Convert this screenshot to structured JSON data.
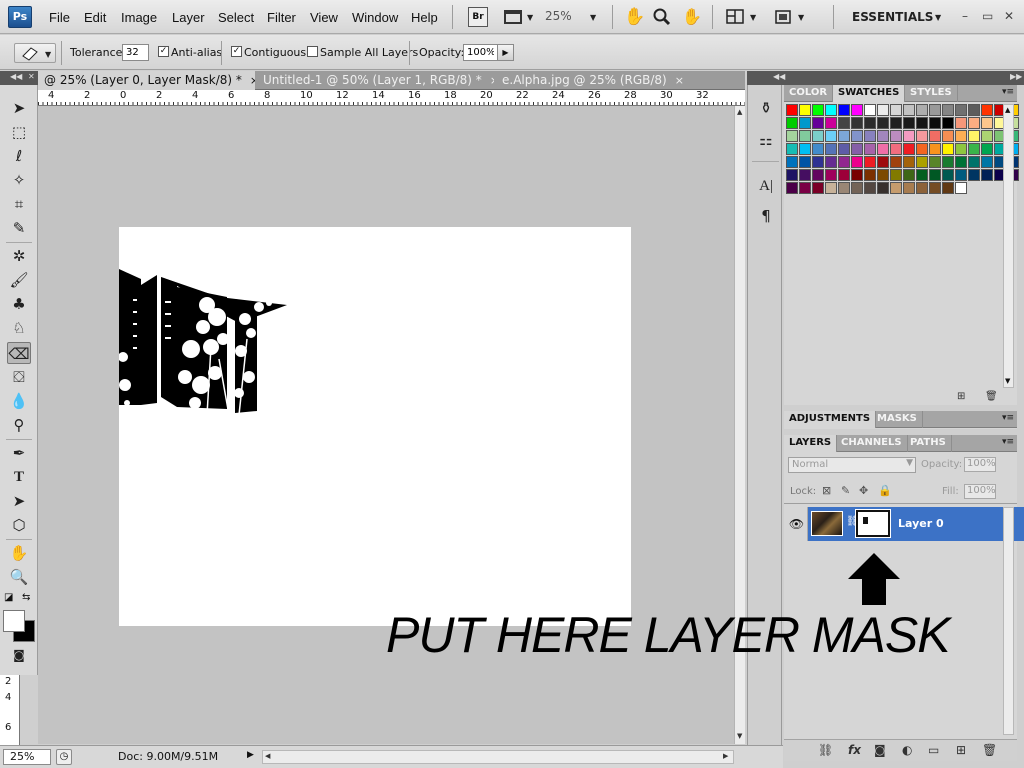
{
  "app": {
    "logo": "Ps"
  },
  "menubar": {
    "items": [
      "File",
      "Edit",
      "Image",
      "Layer",
      "Select",
      "Filter",
      "View",
      "Window",
      "Help"
    ],
    "bridge": "Br",
    "zoom": "25%",
    "workspace": "ESSENTIALS",
    "window_controls": [
      "–",
      "▭",
      "✕"
    ]
  },
  "options": {
    "tolerance_label": "Tolerance:",
    "tolerance_value": "32",
    "antialias_label": "Anti-alias",
    "antialias_checked": true,
    "contiguous_label": "Contiguous",
    "contiguous_checked": true,
    "sample_all_label": "Sample All Layers",
    "sample_all_checked": false,
    "opacity_label": "Opacity:",
    "opacity_value": "100%"
  },
  "doc_tabs": [
    {
      "label": "@ 25% (Layer 0, Layer Mask/8) *",
      "close": "×",
      "active": true
    },
    {
      "label": "Untitled-1 @ 50% (Layer 1, RGB/8) *",
      "close": "×",
      "active": false
    },
    {
      "label": "e.Alpha.jpg @ 25% (RGB/8)",
      "close": "×",
      "active": false
    }
  ],
  "ruler": {
    "h_labels": [
      "4",
      "2",
      "0",
      "2",
      "4",
      "6",
      "8",
      "10",
      "12",
      "14",
      "16",
      "18",
      "20",
      "22",
      "24",
      "26",
      "28",
      "30",
      "32"
    ],
    "v_labels": [
      "2",
      "4",
      "6"
    ]
  },
  "status": {
    "zoom": "25%",
    "doc": "Doc: 9.00M/9.51M"
  },
  "swatch_panel": {
    "tabs": [
      "COLOR",
      "SWATCHES",
      "STYLES"
    ],
    "active": "SWATCHES",
    "colors": [
      "#ff0000",
      "#ffff00",
      "#00ff00",
      "#00ffff",
      "#0000ff",
      "#ff00ff",
      "#ffffff",
      "#ebebeb",
      "#d6d6d6",
      "#c2c2c2",
      "#adadad",
      "#999999",
      "#858585",
      "#707070",
      "#5c5c5c",
      "#ff3300",
      "#cc0000",
      "#ffcc00",
      "#00cc00",
      "#0099cc",
      "#660099",
      "#cc0099",
      "#444444",
      "#333333",
      "#2b2b2b",
      "#262626",
      "#1f1f1f",
      "#1a1a1a",
      "#141414",
      "#0d0d0d",
      "#000000",
      "#f7977a",
      "#fbad82",
      "#fdc68c",
      "#fff799",
      "#c6df9c",
      "#a4d49d",
      "#81ca9d",
      "#7bcdc9",
      "#6ccff7",
      "#7ca6d8",
      "#8293ca",
      "#8881be",
      "#a286bd",
      "#bc8cbf",
      "#f49bc1",
      "#f5999d",
      "#f16d64",
      "#f58e53",
      "#fdae54",
      "#fff467",
      "#acd372",
      "#7dc473",
      "#39b778",
      "#16bcb4",
      "#00bff3",
      "#438ccb",
      "#5573b7",
      "#5e5ca7",
      "#855fa8",
      "#a763a9",
      "#ef6ea8",
      "#f16d7e",
      "#ee1d23",
      "#f36521",
      "#f8931d",
      "#fff100",
      "#8dc63f",
      "#39b44a",
      "#00a650",
      "#00a99e",
      "#00adef",
      "#0072bc",
      "#0054a5",
      "#2f3192",
      "#652c91",
      "#91278f",
      "#ec008c",
      "#ed1c24",
      "#9e0b0f",
      "#a0410d",
      "#a3620a",
      "#aba000",
      "#588528",
      "#197b30",
      "#007236",
      "#00736a",
      "#0076a4",
      "#004a80",
      "#003370",
      "#1d1363",
      "#450e61",
      "#62055f",
      "#9e005c",
      "#9d0039",
      "#790000",
      "#7b3000",
      "#7c4900",
      "#827a00",
      "#3e6617",
      "#045f20",
      "#005824",
      "#005951",
      "#005b7e",
      "#003562",
      "#002056",
      "#0c004b",
      "#30004a",
      "#4b0048",
      "#7a0045",
      "#7a0026",
      "#c7b299",
      "#998675",
      "#736357",
      "#534741",
      "#37302d",
      "#c69c6d",
      "#a77c50",
      "#8c623a",
      "#754c24",
      "#603813",
      "#ffffff"
    ]
  },
  "adjust_panel": {
    "tabs": [
      "ADJUSTMENTS",
      "MASKS"
    ]
  },
  "layers_panel": {
    "tabs": [
      "LAYERS",
      "CHANNELS",
      "PATHS"
    ],
    "blend_mode": "Normal",
    "opacity_label": "Opacity:",
    "opacity_value": "100%",
    "lock_label": "Lock:",
    "fill_label": "Fill:",
    "fill_value": "100%",
    "layer_name": "Layer 0"
  },
  "annotation": "PUT HERE LAYER MASK"
}
